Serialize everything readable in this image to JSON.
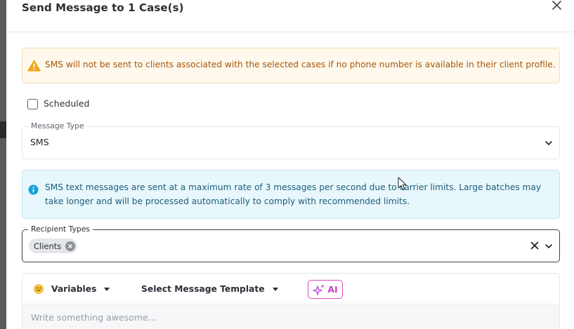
{
  "modal": {
    "title": "Send Message to 1 Case(s)",
    "close_icon": "close-icon"
  },
  "warning": {
    "icon": "warning-triangle-icon",
    "text": "SMS will not be sent to clients associated with the selected cases if no phone number is available in their client profile.",
    "bg_color": "#fff8ec",
    "text_color": "#a4560a"
  },
  "scheduled": {
    "label": "Scheduled",
    "checked": false
  },
  "message_type": {
    "legend": "Message Type",
    "value": "SMS"
  },
  "info": {
    "icon": "info-icon",
    "text": "SMS text messages are sent at a maximum rate of 3 messages per second due to carrier limits. Large batches may take longer and will be processed automatically to comply with recommended limits.",
    "bg_color": "#e8f7fb",
    "text_color": "#1c5d7d"
  },
  "recipient_types": {
    "legend": "Recipient Types",
    "chips": [
      "Clients"
    ]
  },
  "editor": {
    "variables_label": "Variables",
    "template_label": "Select Message Template",
    "ai_label": "AI",
    "placeholder": "Write something awesome..."
  }
}
